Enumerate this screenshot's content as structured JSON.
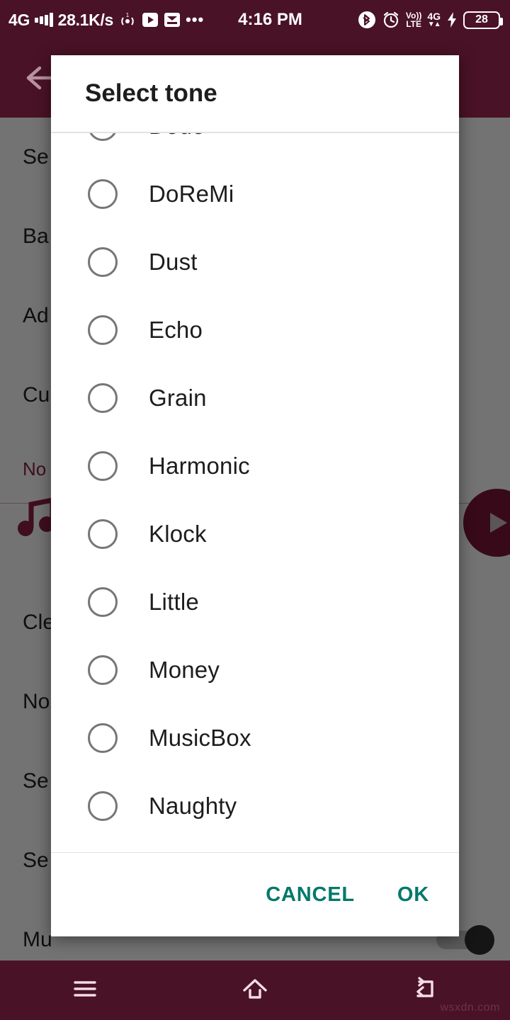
{
  "status_bar": {
    "network_label": "4G",
    "data_rate": "28.1K/s",
    "time": "4:16 PM",
    "battery_percent": "28",
    "volte_top": "Vo))",
    "volte_bottom": "LTE",
    "net_right_label": "4G",
    "net_right_arrows": "▼▲",
    "overflow_dots": "•••",
    "icons": [
      "signal-bars-icon",
      "hotspot-icon",
      "play-store-icon",
      "inbox-icon",
      "more-dots-icon",
      "bluetooth-icon",
      "alarm-clock-icon",
      "volte-icon",
      "network-4g-icon",
      "charging-bolt-icon",
      "battery-icon"
    ]
  },
  "app_behind": {
    "back_icon": "back-arrow-icon",
    "rows": [
      {
        "label": "Se",
        "accent": false,
        "toggle": false
      },
      {
        "label": "Ba",
        "accent": false,
        "toggle": false
      },
      {
        "label": "Ad",
        "accent": false,
        "toggle": false
      },
      {
        "label": "Cu",
        "accent": false,
        "toggle": false
      },
      {
        "label": "No",
        "accent": true,
        "toggle": false
      },
      {
        "label": "",
        "accent": false,
        "toggle": false
      },
      {
        "label": "Cle",
        "accent": false,
        "toggle": false
      },
      {
        "label": "No",
        "accent": false,
        "toggle": false
      },
      {
        "label": "Se",
        "accent": false,
        "toggle": false
      },
      {
        "label": "Se",
        "accent": false,
        "toggle": false
      },
      {
        "label": "Mu",
        "accent": false,
        "toggle": true
      }
    ],
    "music_note_icon": "music-note-icon",
    "play_button_icon": "play-icon"
  },
  "dialog": {
    "title": "Select tone",
    "tones": [
      {
        "label": "Dodo",
        "selected": false
      },
      {
        "label": "DoReMi",
        "selected": false
      },
      {
        "label": "Dust",
        "selected": false
      },
      {
        "label": "Echo",
        "selected": false
      },
      {
        "label": "Grain",
        "selected": false
      },
      {
        "label": "Harmonic",
        "selected": false
      },
      {
        "label": "Klock",
        "selected": false
      },
      {
        "label": "Little",
        "selected": false
      },
      {
        "label": "Money",
        "selected": false
      },
      {
        "label": "MusicBox",
        "selected": false
      },
      {
        "label": "Naughty",
        "selected": false
      }
    ],
    "cancel_label": "CANCEL",
    "ok_label": "OK"
  },
  "nav_bar": {
    "menu_icon": "menu-icon",
    "home_icon": "home-icon",
    "back_icon": "back-icon"
  },
  "watermark": "wsxdn.com",
  "colors": {
    "app_bar": "#4a1226",
    "accent_maroon": "#8e1f43",
    "dialog_action": "#00796b",
    "status_text": "#ffffff"
  }
}
